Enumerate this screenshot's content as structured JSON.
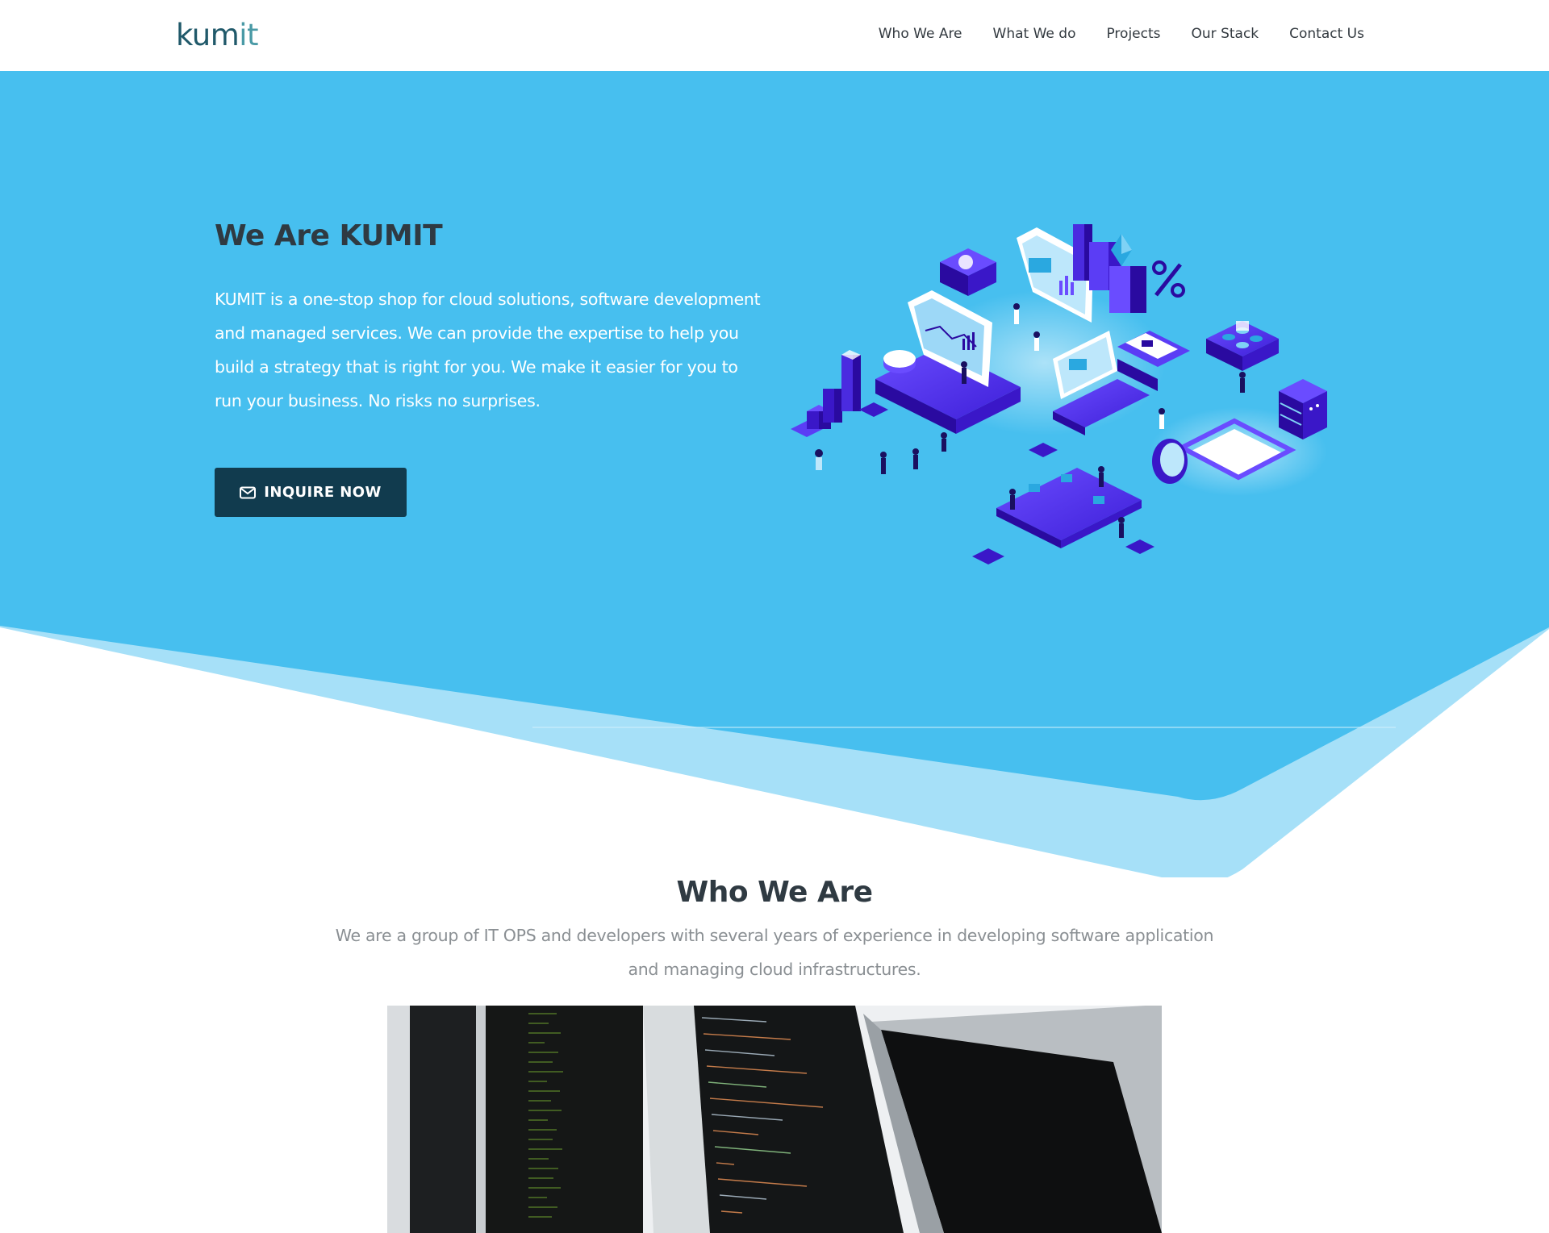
{
  "header": {
    "logo": {
      "main": "kum",
      "accent": "it"
    },
    "nav": [
      {
        "label": "Who We Are"
      },
      {
        "label": "What We do"
      },
      {
        "label": "Projects"
      },
      {
        "label": "Our Stack"
      },
      {
        "label": "Contact Us"
      }
    ]
  },
  "hero": {
    "title": "We Are KUMIT",
    "text": "KUMIT is a one-stop shop for cloud solutions, software development and managed services. We can provide the expertise to help you build a strategy that is right for you. We make it easier for you to run your business. No risks no surprises.",
    "cta": {
      "label": "INQUIRE NOW",
      "icon": "envelope-icon"
    },
    "illustration": "isometric-tech-illustration"
  },
  "who": {
    "title": "Who We Are",
    "text": "We are a group of IT OPS and developers with several years of experience in developing software application and managing cloud infrastructures.",
    "image": "monitors-with-code-photo"
  },
  "colors": {
    "hero_blue": "#47bfef",
    "hero_blue_light": "#a6e0f8",
    "button_dark": "#113b4e",
    "logo_dark": "#20596a",
    "logo_accent": "#4a9aa6",
    "heading": "#2f3a42",
    "body_gray": "#8a8f93"
  }
}
